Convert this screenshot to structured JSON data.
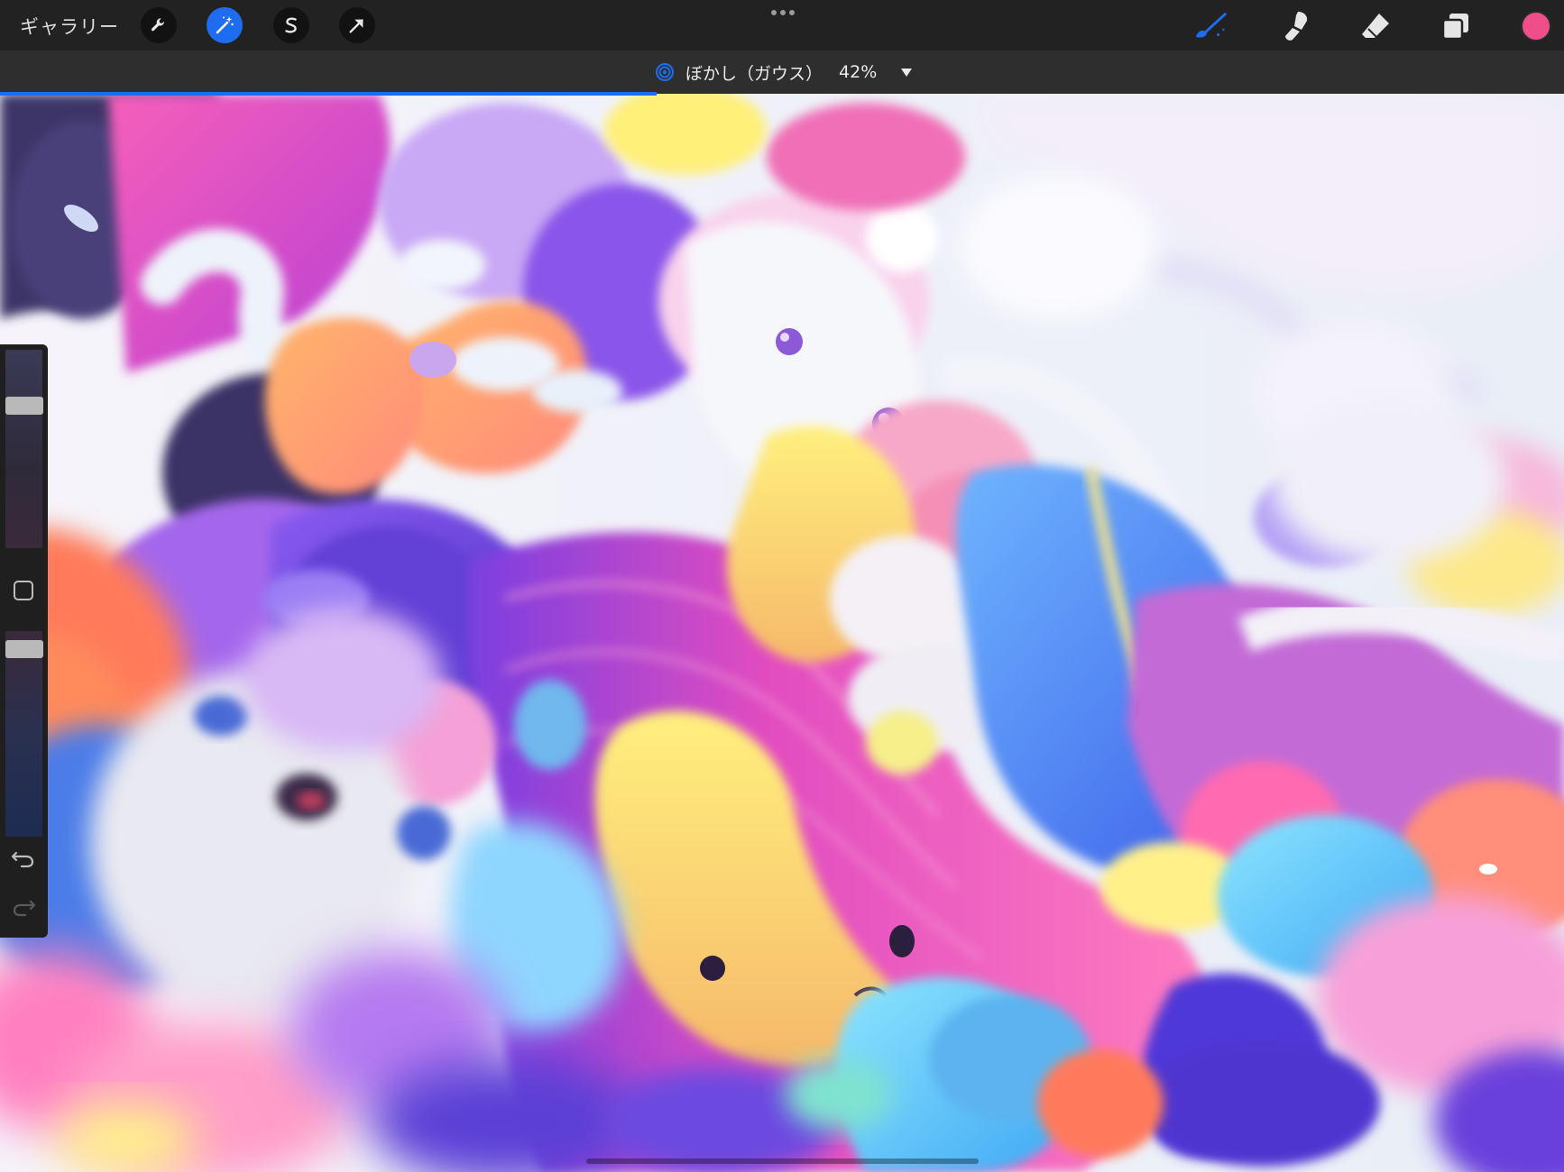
{
  "toolbar": {
    "gallery_label": "ギャラリー",
    "left_tools": [
      "wrench-icon",
      "magic-wand-icon",
      "selection-s-icon",
      "transform-arrow-icon"
    ],
    "active_tool": "magic-wand-icon",
    "right_tools": [
      "brush-icon",
      "smudge-icon",
      "eraser-icon",
      "layers-icon"
    ],
    "active_right_tool": "brush-icon",
    "current_color": "#ee4f8a"
  },
  "filter": {
    "icon": "gaussian-blur-icon",
    "name": "ぼかし（ガウス）",
    "value": "42%",
    "progress_percent": 42
  },
  "sidebar": {
    "brush_size_level": 0.19,
    "opacity_level": 0.06,
    "modify_button_icon": "square-icon",
    "undo_icon": "undo-icon",
    "redo_icon": "redo-icon"
  },
  "colors": {
    "accent": "#1e6df0",
    "toolbar_bg": "#222222",
    "filterbar_bg": "#2e2e2e"
  }
}
